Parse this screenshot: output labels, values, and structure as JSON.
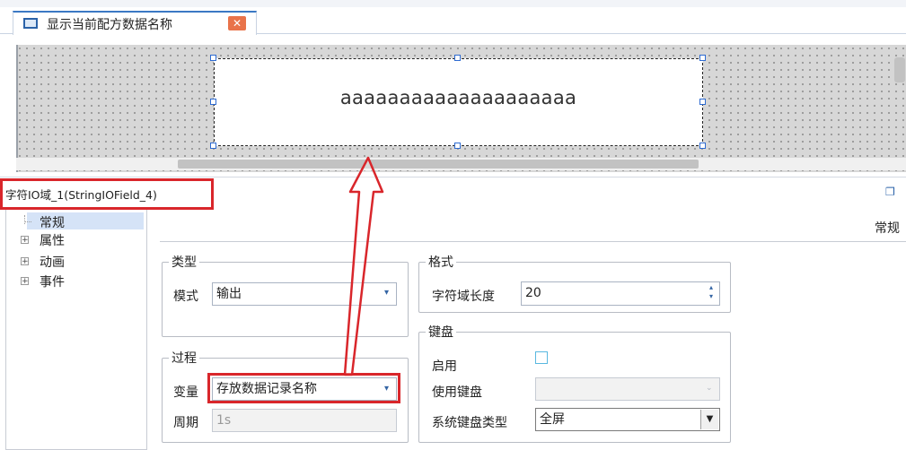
{
  "tab": {
    "title": "显示当前配方数据名称",
    "close_label": "✕",
    "icon": "screen-icon"
  },
  "canvas": {
    "field_text": "aaaaaaaaaaaaaaaaaaaa"
  },
  "properties": {
    "object_title": "字符IO域_1(StringIOField_4)",
    "section_title": "常规",
    "tree": [
      {
        "label": "常规",
        "expander": ""
      },
      {
        "label": "属性",
        "expander": "+"
      },
      {
        "label": "动画",
        "expander": "+"
      },
      {
        "label": "事件",
        "expander": "+"
      }
    ],
    "type_group": {
      "title": "类型",
      "mode_label": "模式",
      "mode_value": "输出"
    },
    "process_group": {
      "title": "过程",
      "variable_label": "变量",
      "variable_value": "存放数据记录名称",
      "cycle_label": "周期",
      "cycle_value": "1s"
    },
    "format_group": {
      "title": "格式",
      "length_label": "字符域长度",
      "length_value": "20"
    },
    "keyboard_group": {
      "title": "键盘",
      "enable_label": "启用",
      "use_keyboard_label": "使用键盘",
      "use_keyboard_value": "",
      "system_keyboard_label": "系统键盘类型",
      "system_keyboard_value": "全屏"
    }
  },
  "colors": {
    "highlight_red": "#d9262b",
    "accent_blue": "#2e6bd1"
  }
}
